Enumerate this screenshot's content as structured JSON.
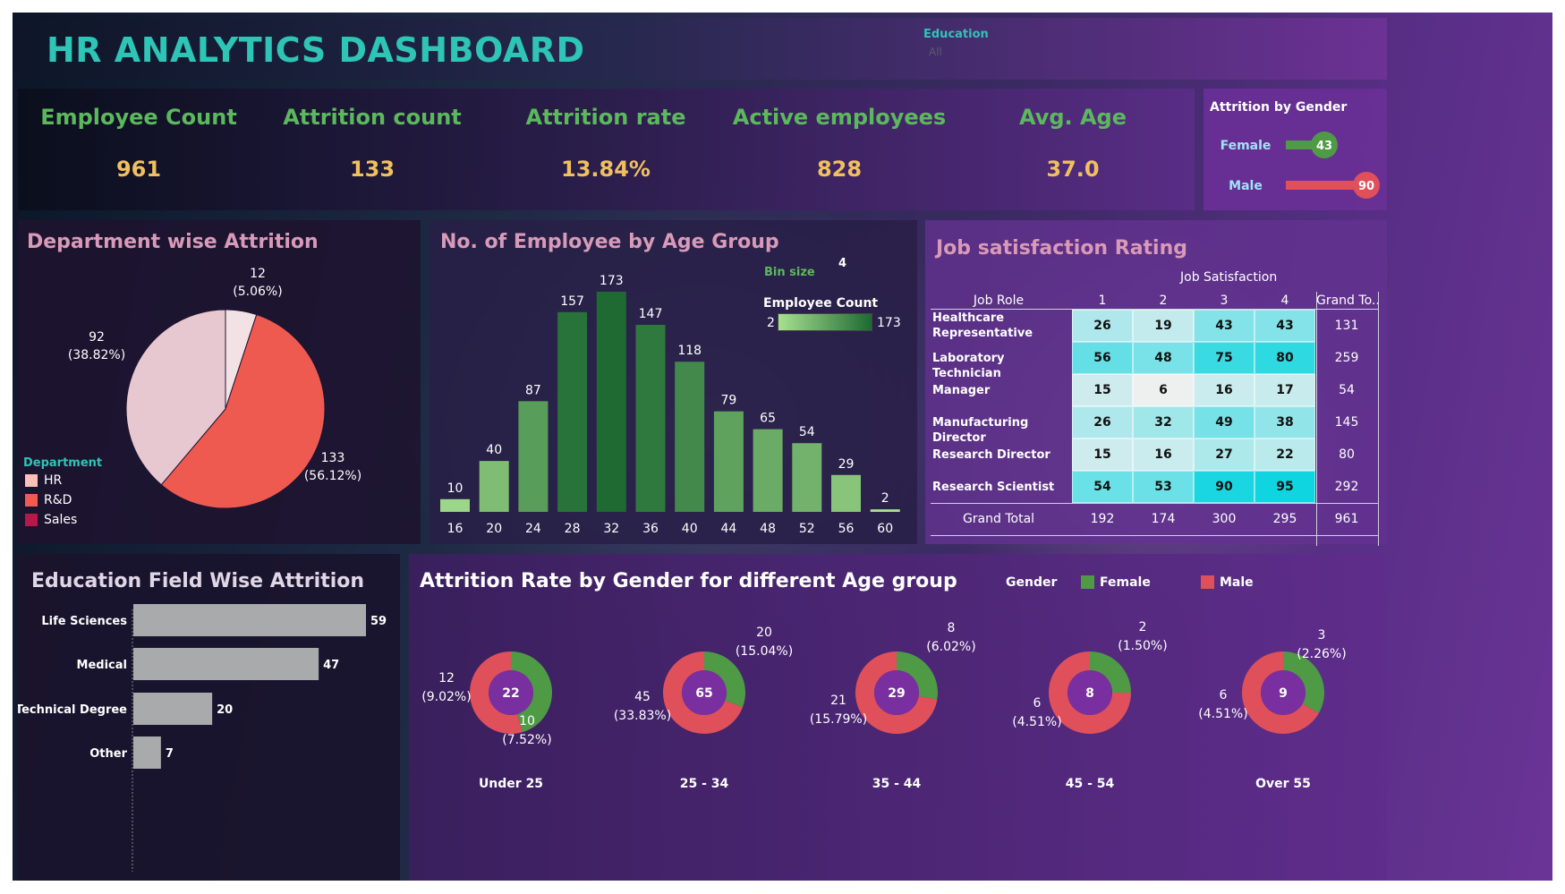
{
  "header": {
    "title": "HR ANALYTICS DASHBOARD",
    "filter_label": "Education",
    "filter_value": "All"
  },
  "kpis": [
    {
      "label": "Employee Count",
      "value": "961"
    },
    {
      "label": "Attrition count",
      "value": "133"
    },
    {
      "label": "Attrition rate",
      "value": "13.84%"
    },
    {
      "label": "Active employees",
      "value": "828"
    },
    {
      "label": "Avg. Age",
      "value": "37.0"
    }
  ],
  "gender_attrition": {
    "title": "Attrition by Gender",
    "rows": [
      {
        "label": "Female",
        "value": 43,
        "display": "43",
        "color": "#4e9a45"
      },
      {
        "label": "Male",
        "value": 90,
        "display": "90",
        "color": "#e0505a"
      }
    ]
  },
  "department": {
    "title": "Department wise Attrition",
    "legend_title": "Department",
    "legend": [
      {
        "name": "HR",
        "color": "#f8c0b8"
      },
      {
        "name": "R&D",
        "color": "#f05a50"
      },
      {
        "name": "Sales",
        "color": "#b81848"
      }
    ],
    "slice_labels": [
      {
        "count": "12",
        "pct": "(5.06%)"
      },
      {
        "count": "133",
        "pct": "(56.12%)"
      },
      {
        "count": "92",
        "pct": "(38.82%)"
      }
    ]
  },
  "age_group": {
    "title": "No. of Employee by Age Group",
    "bin_label": "Bin size",
    "bin_value": "4",
    "scale_label": "Employee Count",
    "scale_min": "2",
    "scale_max": "173"
  },
  "job_satisfaction": {
    "title": "Job satisfaction Rating",
    "column_group": "Job Satisfaction",
    "row_header": "Job Role",
    "columns": [
      "1",
      "2",
      "3",
      "4"
    ],
    "total_header": "Grand To..",
    "rows": [
      {
        "role": "Healthcare Representative",
        "values": [
          26,
          19,
          43,
          43
        ],
        "total": 131
      },
      {
        "role": "Laboratory Technician",
        "values": [
          56,
          48,
          75,
          80
        ],
        "total": 259
      },
      {
        "role": "Manager",
        "values": [
          15,
          6,
          16,
          17
        ],
        "total": 54
      },
      {
        "role": "Manufacturing Director",
        "values": [
          26,
          32,
          49,
          38
        ],
        "total": 145
      },
      {
        "role": "Research Director",
        "values": [
          15,
          16,
          27,
          22
        ],
        "total": 80
      },
      {
        "role": "Research Scientist",
        "values": [
          54,
          53,
          90,
          95
        ],
        "total": 292
      }
    ],
    "grand_total_label": "Grand Total",
    "grand_total_values": [
      192,
      174,
      300,
      295
    ],
    "grand_total": 961
  },
  "education": {
    "title": "Education Field Wise Attrition"
  },
  "donuts": {
    "title": "Attrition Rate by Gender for different Age group",
    "legend_title": "Gender",
    "legend": [
      {
        "name": "Female",
        "color": "#4e9a45"
      },
      {
        "name": "Male",
        "color": "#e0505a"
      }
    ],
    "groups": [
      {
        "label": "Under 25",
        "total": "22",
        "female": 10,
        "male": 12,
        "female_count": "10",
        "female_pct": "(7.52%)",
        "male_count": "12",
        "male_pct": "(9.02%)"
      },
      {
        "label": "25 - 34",
        "total": "65",
        "female": 20,
        "male": 45,
        "female_count": "20",
        "female_pct": "(15.04%)",
        "male_count": "45",
        "male_pct": "(33.83%)"
      },
      {
        "label": "35 - 44",
        "total": "29",
        "female": 8,
        "male": 21,
        "female_count": "8",
        "female_pct": "(6.02%)",
        "male_count": "21",
        "male_pct": "(15.79%)"
      },
      {
        "label": "45 - 54",
        "total": "8",
        "female": 2,
        "male": 6,
        "female_count": "2",
        "female_pct": "(1.50%)",
        "male_count": "6",
        "male_pct": "(4.51%)"
      },
      {
        "label": "Over 55",
        "total": "9",
        "female": 3,
        "male": 6,
        "female_count": "3",
        "female_pct": "(2.26%)",
        "male_count": "6",
        "male_pct": "(4.51%)"
      }
    ]
  },
  "colors": {
    "title_teal": "#2ec4b6",
    "kpi_green": "#5cb85c",
    "kpi_gold": "#f0c060",
    "panel_title_pink": "#d89ab8",
    "female": "#4e9a45",
    "male": "#e0505a",
    "donut_center": "#7a2fa0"
  },
  "chart_data": [
    {
      "type": "pie",
      "title": "Department wise Attrition",
      "categories": [
        "HR",
        "R&D",
        "Sales"
      ],
      "values": [
        12,
        133,
        92
      ],
      "percent": [
        5.06,
        56.12,
        38.82
      ]
    },
    {
      "type": "bar",
      "title": "No. of Employee by Age Group",
      "categories": [
        "16",
        "20",
        "24",
        "28",
        "32",
        "36",
        "40",
        "44",
        "48",
        "52",
        "56",
        "60"
      ],
      "values": [
        10,
        40,
        87,
        157,
        173,
        147,
        118,
        79,
        65,
        54,
        29,
        2
      ],
      "color_scale": {
        "min": 2,
        "max": 173
      }
    },
    {
      "type": "bar",
      "title": "Education Field Wise Attrition",
      "orientation": "horizontal",
      "categories": [
        "Life Sciences",
        "Medical",
        "Technical Degree",
        "Other"
      ],
      "values": [
        59,
        47,
        20,
        7
      ]
    },
    {
      "type": "bar",
      "title": "Attrition by Gender",
      "orientation": "horizontal",
      "categories": [
        "Female",
        "Male"
      ],
      "values": [
        43,
        90
      ]
    },
    {
      "type": "heatmap",
      "title": "Job satisfaction Rating",
      "x": [
        "1",
        "2",
        "3",
        "4"
      ],
      "y": [
        "Healthcare Representative",
        "Laboratory Technician",
        "Manager",
        "Manufacturing Director",
        "Research Director",
        "Research Scientist"
      ],
      "values": [
        [
          26,
          19,
          43,
          43
        ],
        [
          56,
          48,
          75,
          80
        ],
        [
          15,
          6,
          16,
          17
        ],
        [
          26,
          32,
          49,
          38
        ],
        [
          15,
          16,
          27,
          22
        ],
        [
          54,
          53,
          90,
          95
        ]
      ]
    },
    {
      "type": "pie",
      "title": "Attrition Rate by Gender for different Age group",
      "categories": [
        "Under 25",
        "25 - 34",
        "35 - 44",
        "45 - 54",
        "Over 55"
      ],
      "series": [
        {
          "name": "Female",
          "values": [
            10,
            20,
            8,
            2,
            3
          ]
        },
        {
          "name": "Male",
          "values": [
            12,
            45,
            21,
            6,
            6
          ]
        }
      ]
    }
  ]
}
